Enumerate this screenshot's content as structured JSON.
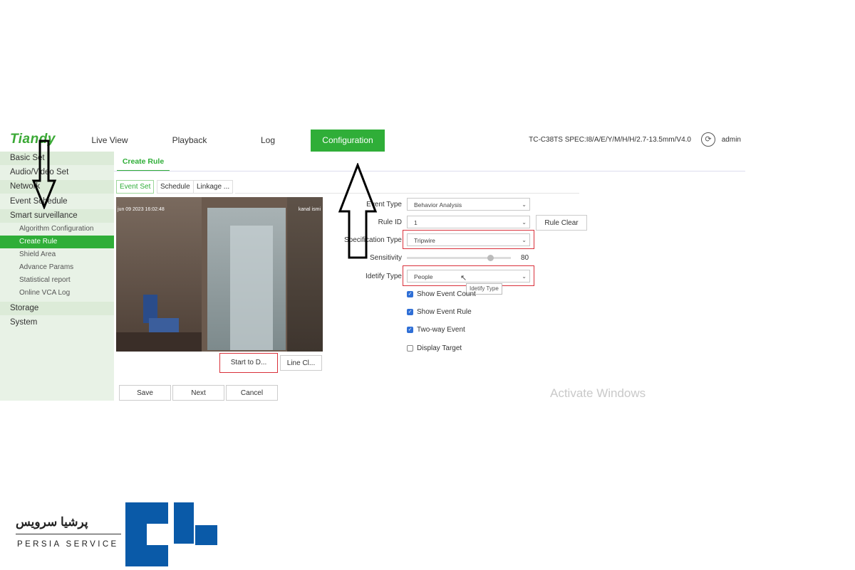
{
  "header": {
    "logo": "Tiandy",
    "nav": [
      "Live View",
      "Playback",
      "Log",
      "Configuration"
    ],
    "active_nav": "Configuration",
    "device_info": "TC-C38TS SPEC:I8/A/E/Y/M/H/H/2.7-13.5mm/V4.0",
    "user": "admin"
  },
  "sidebar": {
    "items": [
      "Basic Set",
      "Audio/Video Set",
      "Network",
      "Event Schedule",
      "Smart surveillance"
    ],
    "sub_items": [
      "Algorithm Configuration",
      "Create Rule",
      "Shield Area",
      "Advance Params",
      "Statistical report",
      "Online VCA Log"
    ],
    "active_sub": "Create Rule",
    "bottom_items": [
      "Storage",
      "System"
    ]
  },
  "page": {
    "tab": "Create Rule",
    "subtabs": [
      "Event Set",
      "Schedule",
      "Linkage ..."
    ],
    "video_timestamp": "jun 09 2023 16:02:48",
    "video_channel": "kanal ismi",
    "start_button": "Start to D...",
    "line_clear_button": "Line Cl...",
    "save": "Save",
    "next": "Next",
    "cancel": "Cancel"
  },
  "form": {
    "event_type_label": "Event Type",
    "event_type": "Behavior Analysis",
    "rule_id_label": "Rule ID",
    "rule_id": "1",
    "rule_clear": "Rule Clear",
    "spec_type_label": "Specification Type",
    "spec_type": "Tripwire",
    "sensitivity_label": "Sensitivity",
    "sensitivity": "80",
    "sensitivity_level": 0.8,
    "identify_type_label": "Idetify Type",
    "identify_type": "People",
    "tooltip": "Idetify Type",
    "checkboxes": [
      {
        "label": "Show Event Count",
        "checked": true
      },
      {
        "label": "Show Event Rule",
        "checked": true
      },
      {
        "label": "Two-way Event",
        "checked": true
      },
      {
        "label": "Display Target",
        "checked": false
      }
    ]
  },
  "watermark": "Activate Windows",
  "brand": {
    "fa": "پرشیا سرویس",
    "en": "PERSIA SERVICE",
    "color": "#0a5aa8"
  }
}
